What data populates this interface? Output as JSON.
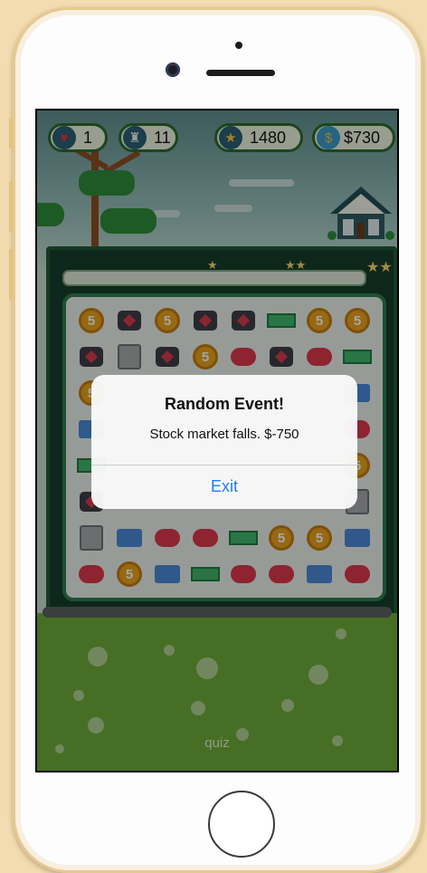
{
  "hud": {
    "lives": "1",
    "moves": "11",
    "score": "1480",
    "money": "$730"
  },
  "progress_stars": [
    "★",
    "★★",
    "★★"
  ],
  "grid": [
    [
      "coin",
      "bag",
      "coin",
      "bag",
      "bag",
      "cash",
      "coin",
      "coin"
    ],
    [
      "bag",
      "safe",
      "bag",
      "coin",
      "pig",
      "bag",
      "pig",
      "cash"
    ],
    [
      "coin",
      "",
      "",
      "",
      "",
      "",
      "",
      "card"
    ],
    [
      "card",
      "",
      "",
      "",
      "",
      "",
      "",
      "pig"
    ],
    [
      "cash",
      "",
      "",
      "",
      "",
      "",
      "",
      "coin"
    ],
    [
      "bag",
      "",
      "",
      "",
      "",
      "",
      "",
      "safe"
    ],
    [
      "safe",
      "card",
      "pig",
      "pig",
      "cash",
      "coin",
      "coin",
      "card"
    ],
    [
      "pig",
      "coin",
      "card",
      "cash",
      "pig",
      "pig",
      "card",
      "pig"
    ]
  ],
  "coin_label": "5",
  "footer": {
    "quiz": "quiz"
  },
  "dialog": {
    "title": "Random Event!",
    "message": "Stock market falls. $-750",
    "exit_label": "Exit"
  },
  "colors": {
    "accent_button": "#1f7cf0",
    "board_border": "#2d7b4a",
    "grass": "#6ea93a"
  }
}
